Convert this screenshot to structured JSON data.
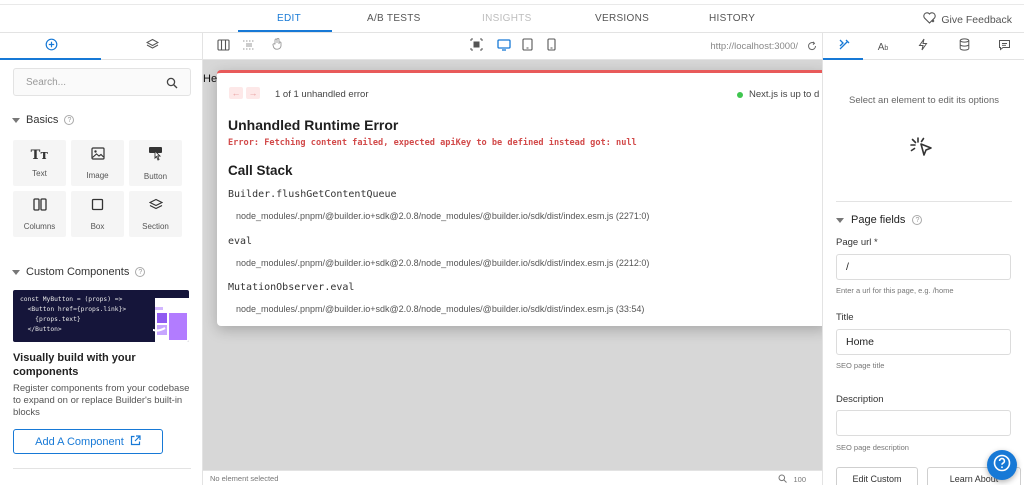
{
  "tabs": [
    "EDIT",
    "A/B TESTS",
    "INSIGHTS",
    "VERSIONS",
    "HISTORY"
  ],
  "feedback_label": "Give Feedback",
  "left": {
    "search_placeholder": "Search...",
    "basics_title": "Basics",
    "blocks": [
      "Text",
      "Image",
      "Button",
      "Columns",
      "Box",
      "Section"
    ],
    "custom_title": "Custom Components",
    "code_lines": [
      "const MyButton = (props) =>",
      "  <Button href={props.link}>",
      "    {props.text}",
      "  </Button>"
    ],
    "cc_title": "Visually build with your components",
    "cc_desc": "Register components from your codebase to expand on or replace Builder's built-in blocks",
    "add_button": "Add A Component"
  },
  "canvas": {
    "url": "http://localhost:3000/",
    "page_text": "He",
    "status_left": "No element selected",
    "zoom": "100"
  },
  "error": {
    "count": "1 of 1 unhandled error",
    "nextjs": "Next.js is up to d",
    "title": "Unhandled Runtime Error",
    "message": "Error: Fetching content failed, expected apiKey to be defined instead got: null",
    "call_stack_title": "Call Stack",
    "frames": [
      {
        "fn": "Builder.flushGetContentQueue",
        "path": "node_modules/.pnpm/@builder.io+sdk@2.0.8/node_modules/@builder.io/sdk/dist/index.esm.js (2271:0)"
      },
      {
        "fn": "eval",
        "path": "node_modules/.pnpm/@builder.io+sdk@2.0.8/node_modules/@builder.io/sdk/dist/index.esm.js (2212:0)"
      },
      {
        "fn": "MutationObserver.eval",
        "path": "node_modules/.pnpm/@builder.io+sdk@2.0.8/node_modules/@builder.io/sdk/dist/index.esm.js (33:54)"
      }
    ]
  },
  "right": {
    "hint": "Select an element to edit its options",
    "page_fields_title": "Page fields",
    "page_url_label": "Page url *",
    "page_url_value": "/",
    "page_url_help": "Enter a url for this page, e.g. /home",
    "title_label": "Title",
    "title_value": "Home",
    "title_help": "SEO page title",
    "description_label": "Description",
    "description_value": "",
    "description_help": "SEO page description",
    "edit_custom_button": "Edit Custom",
    "learn_about_button": "Learn About"
  },
  "colors": {
    "accent": "#1779d6",
    "error": "#d24a4a",
    "error_bar": "#e85a5a",
    "ok": "#3fc54f"
  }
}
